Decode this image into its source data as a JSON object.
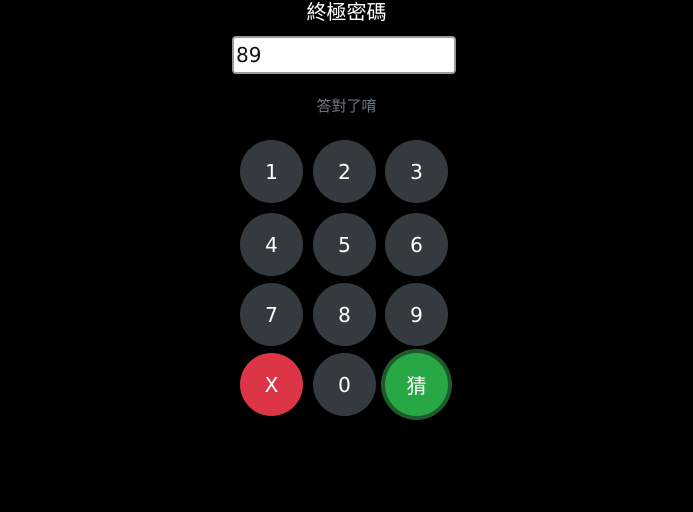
{
  "title": "終極密碼",
  "input": {
    "value": "89"
  },
  "status": "答對了唷",
  "keypad": {
    "k1": "1",
    "k2": "2",
    "k3": "3",
    "k4": "4",
    "k5": "5",
    "k6": "6",
    "k7": "7",
    "k8": "8",
    "k9": "9",
    "clear": "X",
    "k0": "0",
    "guess": "猜"
  },
  "colors": {
    "background": "#000000",
    "key": "#343a40",
    "clear": "#dc3545",
    "guess": "#28a745",
    "status": "#6c757d"
  }
}
